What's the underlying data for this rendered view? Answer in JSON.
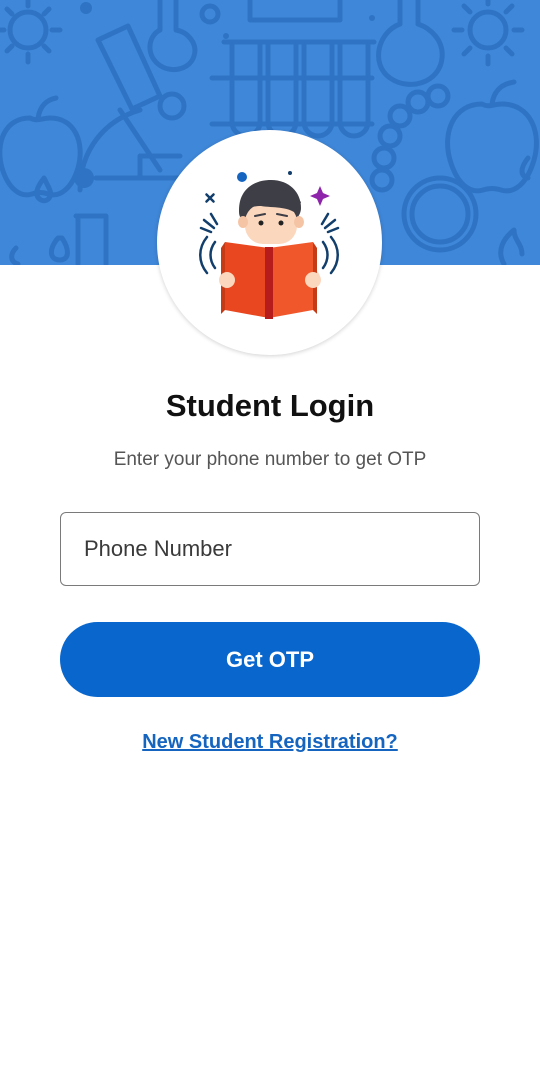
{
  "header": {
    "banner_pattern": "science-doodle-pattern",
    "banner_color": "#3f87d9",
    "avatar_illustration": "student-reading-book-illustration"
  },
  "login": {
    "title": "Student Login",
    "subtitle": "Enter your phone number to get OTP",
    "phone_placeholder": "Phone Number",
    "phone_value": "",
    "submit_label": "Get OTP",
    "register_link_label": "New Student Registration?"
  },
  "colors": {
    "primary_button": "#0866cc",
    "link": "#1565c0",
    "book": "#e8471f"
  }
}
